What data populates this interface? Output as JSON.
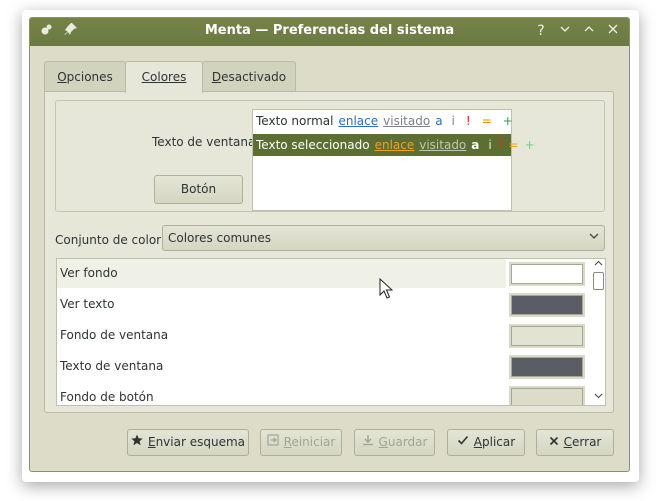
{
  "window": {
    "title": "Menta — Preferencias del sistema"
  },
  "titlebar_icons": {
    "left1": "app-icon",
    "left2": "pin-icon",
    "help": "?",
    "minimize": "⌄",
    "maximize": "⌃",
    "close": "✕"
  },
  "tabs": [
    {
      "label": "Opciones",
      "mnemonic": "O",
      "rest": "pciones"
    },
    {
      "label": "Colores",
      "mnemonic": "",
      "rest": "Colores"
    },
    {
      "label": "Desactivado",
      "mnemonic": "D",
      "rest": "esactivado"
    }
  ],
  "preview": {
    "label": "Texto de ventana",
    "button": "Botón",
    "normal_row": {
      "text": "Texto normal",
      "link": "enlace",
      "visited": "visitado",
      "a": "a",
      "i": "i",
      "bang": "!",
      "eq": "=",
      "plus": "+"
    },
    "selected_row": {
      "text": "Texto seleccionado",
      "link": "enlace",
      "visited": "visitado",
      "a": "a",
      "i": "i",
      "bang": "!",
      "eq": "=",
      "plus": "+"
    }
  },
  "color_set": {
    "label": "Conjunto de color:",
    "value": "Colores comunes"
  },
  "color_list": [
    {
      "label": "Ver fondo",
      "color": "#ffffff"
    },
    {
      "label": "Ver texto",
      "color": "#5a5c66"
    },
    {
      "label": "Fondo de ventana",
      "color": "#e2e3d3"
    },
    {
      "label": "Texto de ventana",
      "color": "#5a5c66"
    },
    {
      "label": "Fondo de botón",
      "color": "#dcdcc8"
    }
  ],
  "footer": {
    "send": {
      "mnemonic": "E",
      "rest": "nviar esquema"
    },
    "reset": {
      "mnemonic": "R",
      "rest": "einiciar"
    },
    "save": {
      "mnemonic": "G",
      "rest": "uardar"
    },
    "apply": {
      "mnemonic": "A",
      "rest": "plicar"
    },
    "close": {
      "mnemonic": "C",
      "rest": "errar"
    }
  },
  "colors": {
    "titlebar": "#6b7a41",
    "selection": "#5c6e32",
    "link": "#2a6fc1",
    "visited": "#7a7f8a",
    "warning": "#e08a00",
    "negative": "#d0261c",
    "neutral": "#e38a00",
    "positive": "#27a04a"
  }
}
